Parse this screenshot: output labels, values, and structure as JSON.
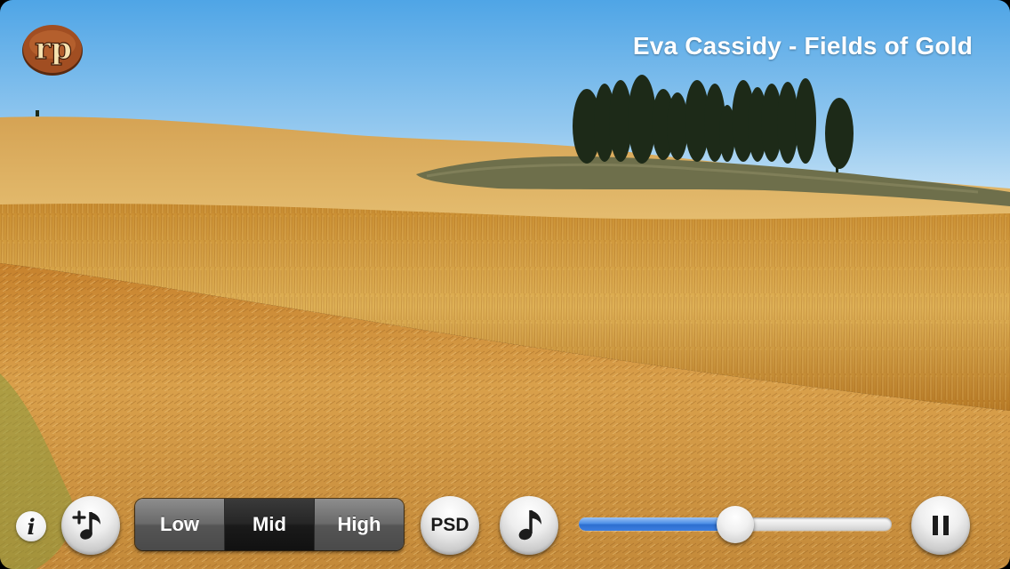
{
  "app": {
    "logo_text": "rp",
    "now_playing": "Eva Cassidy - Fields of Gold"
  },
  "controls": {
    "info_label": "i",
    "add_song_icon": "add-music-note-icon",
    "quality_options": [
      "Low",
      "Mid",
      "High"
    ],
    "quality_selected": "Mid",
    "psd_label": "PSD",
    "song_icon": "music-note-icon",
    "volume_level": 0.5,
    "pause_icon": "pause-icon"
  },
  "colors": {
    "sky_top": "#4fa5e6",
    "sky_bottom": "#cfe7f7",
    "field_gold": "#d9a548",
    "slider_fill": "#3c7ee0",
    "logo_brown": "#9a4a22"
  }
}
